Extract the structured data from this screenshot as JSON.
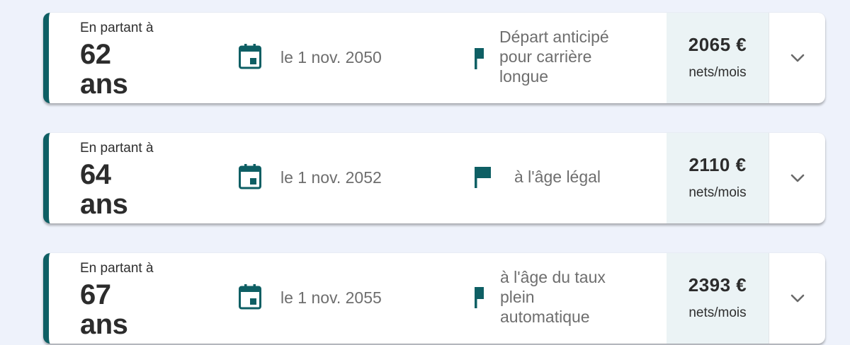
{
  "colors": {
    "accent": "#0e5f64",
    "amount_panel_bg": "#ebf3f5",
    "page_bg": "#eef2fb"
  },
  "options": [
    {
      "prefix": "En partant à",
      "age": "62",
      "age_unit": "ans",
      "date": "le 1 nov. 2050",
      "date_icon": "calendar-icon",
      "type_icon": "flag-icon",
      "type_lines": [
        "Départ anticipé",
        "pour carrière",
        "longue"
      ],
      "amount": "2065 €",
      "amount_unit": "nets/mois",
      "expand_icon": "chevron-down-icon"
    },
    {
      "prefix": "En partant à",
      "age": "64",
      "age_unit": "ans",
      "date": "le 1 nov. 2052",
      "date_icon": "calendar-icon",
      "type_icon": "flag-icon",
      "type_lines": [
        "à l'âge légal"
      ],
      "amount": "2110 €",
      "amount_unit": "nets/mois",
      "expand_icon": "chevron-down-icon"
    },
    {
      "prefix": "En partant à",
      "age": "67",
      "age_unit": "ans",
      "date": "le 1 nov. 2055",
      "date_icon": "calendar-icon",
      "type_icon": "flag-icon",
      "type_lines": [
        "à l'âge du taux",
        "plein",
        "automatique"
      ],
      "amount": "2393 €",
      "amount_unit": "nets/mois",
      "expand_icon": "chevron-down-icon"
    }
  ]
}
